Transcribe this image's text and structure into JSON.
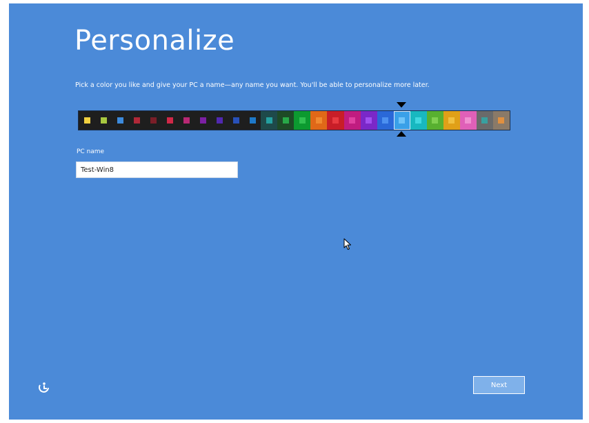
{
  "title": "Personalize",
  "subtitle": "Pick a color you like and give your PC a name—any name you want. You'll be able to personalize more later.",
  "palette": {
    "selected_index": 19,
    "swatches": [
      {
        "bg": "#1e1e1e",
        "chip": "#f0d040"
      },
      {
        "bg": "#1e1e1e",
        "chip": "#a8c840"
      },
      {
        "bg": "#1e1e1e",
        "chip": "#3c8adc"
      },
      {
        "bg": "#1e1e1e",
        "chip": "#b02838"
      },
      {
        "bg": "#1e1e1e",
        "chip": "#7a1e28"
      },
      {
        "bg": "#1e1e1e",
        "chip": "#d02848"
      },
      {
        "bg": "#1e1e1e",
        "chip": "#b82874"
      },
      {
        "bg": "#1e1e1e",
        "chip": "#7c20a4"
      },
      {
        "bg": "#1e1e1e",
        "chip": "#5028b0"
      },
      {
        "bg": "#1e1e1e",
        "chip": "#2850b8"
      },
      {
        "bg": "#1e1e1e",
        "chip": "#1e78c8"
      },
      {
        "bg": "#1e4a4a",
        "chip": "#24a0a0"
      },
      {
        "bg": "#1e4a26",
        "chip": "#28a848"
      },
      {
        "bg": "#0c9a30",
        "chip": "#30c050"
      },
      {
        "bg": "#e06818",
        "chip": "#f08a30"
      },
      {
        "bg": "#c81e28",
        "chip": "#e83a40"
      },
      {
        "bg": "#c01c80",
        "chip": "#e040a0"
      },
      {
        "bg": "#7a28c8",
        "chip": "#a050f0"
      },
      {
        "bg": "#2a68d8",
        "chip": "#4c90f0"
      },
      {
        "bg": "#3aa0e8",
        "chip": "#70c4f8"
      },
      {
        "bg": "#18b8c0",
        "chip": "#40d8e0"
      },
      {
        "bg": "#58b030",
        "chip": "#80d050"
      },
      {
        "bg": "#e0a018",
        "chip": "#f0c040"
      },
      {
        "bg": "#e060b8",
        "chip": "#f090d0"
      },
      {
        "bg": "#6a6a6a",
        "chip": "#38a0a0"
      },
      {
        "bg": "#8a7a68",
        "chip": "#e09040"
      }
    ]
  },
  "pc_name": {
    "label": "PC name",
    "value": "Test-Win8"
  },
  "next_button": {
    "label": "Next"
  },
  "icons": {
    "ease_of_access": "ease-of-access-icon",
    "cursor": "mouse-pointer-icon"
  },
  "colors": {
    "background": "#4b8ad8",
    "button_fill": "#7fb1ea"
  }
}
